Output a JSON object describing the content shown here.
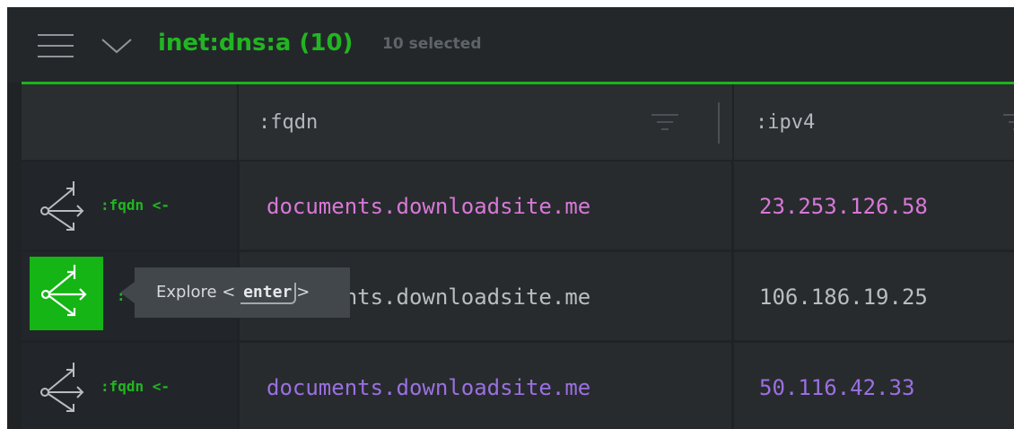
{
  "header": {
    "title": "inet:dns:a (10)",
    "subtitle": "10 selected",
    "menu_icon": "hamburger-menu-icon",
    "collapse_icon": "chevron-down-icon"
  },
  "columns": [
    {
      "label": ":fqdn"
    },
    {
      "label": ":ipv4"
    }
  ],
  "rows": [
    {
      "pivot_label": ":fqdn <-",
      "fqdn": "documents.downloadsite.me",
      "ipv4": "23.253.126.58",
      "fqdn_color": "#d878d6",
      "ipv4_color": "#d878d6"
    },
    {
      "pivot_label": ":",
      "fqdn": "documents.downloadsite.me",
      "ipv4": "106.186.19.25",
      "fqdn_color": "#b9bdc0",
      "ipv4_color": "#b9bdc0"
    },
    {
      "pivot_label": ":fqdn <-",
      "fqdn": "documents.downloadsite.me",
      "ipv4": "50.116.42.33",
      "fqdn_color": "#9b70e0",
      "ipv4_color": "#9b70e0"
    }
  ],
  "tooltip": {
    "prefix": "Explore <",
    "key": "enter",
    "suffix": ">"
  },
  "colors": {
    "accent": "#22b522",
    "button_bg": "#14b514",
    "panel_bg": "#1f2326"
  }
}
